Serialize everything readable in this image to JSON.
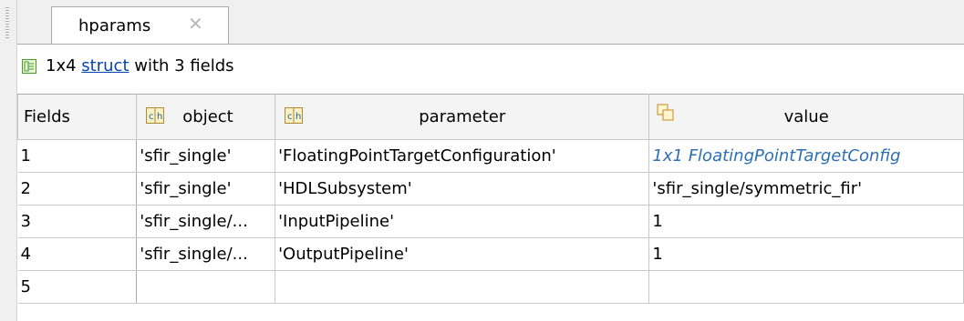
{
  "tab": {
    "label": "hparams",
    "close_glyph": "✕"
  },
  "info": {
    "size": "1x4",
    "link": "struct",
    "suffix": "with 3 fields"
  },
  "table": {
    "columns": [
      {
        "label": "Fields",
        "icon": "none"
      },
      {
        "label": "object",
        "icon": "char-array-icon"
      },
      {
        "label": "parameter",
        "icon": "char-array-icon"
      },
      {
        "label": "value",
        "icon": "mixed-type-icon"
      }
    ],
    "rows": [
      {
        "num": "1",
        "object": "'sfir_single'",
        "parameter": "'FloatingPointTargetConfiguration'",
        "value": "1x1 FloatingPointTargetConfig",
        "value_link": true
      },
      {
        "num": "2",
        "object": "'sfir_single'",
        "parameter": "'HDLSubsystem'",
        "value": "'sfir_single/symmetric_fir'",
        "value_link": false
      },
      {
        "num": "3",
        "object": "'sfir_single/...",
        "parameter": "'InputPipeline'",
        "value": "1",
        "value_link": false
      },
      {
        "num": "4",
        "object": "'sfir_single/...",
        "parameter": "'OutputPipeline'",
        "value": "1",
        "value_link": false
      },
      {
        "num": "5",
        "object": "",
        "parameter": "",
        "value": "",
        "value_link": false
      }
    ]
  },
  "colors": {
    "link": "#0645ad",
    "object_link": "#2c6fb3",
    "header_bg": "#f4f4f4",
    "border": "#c8c8c8"
  }
}
